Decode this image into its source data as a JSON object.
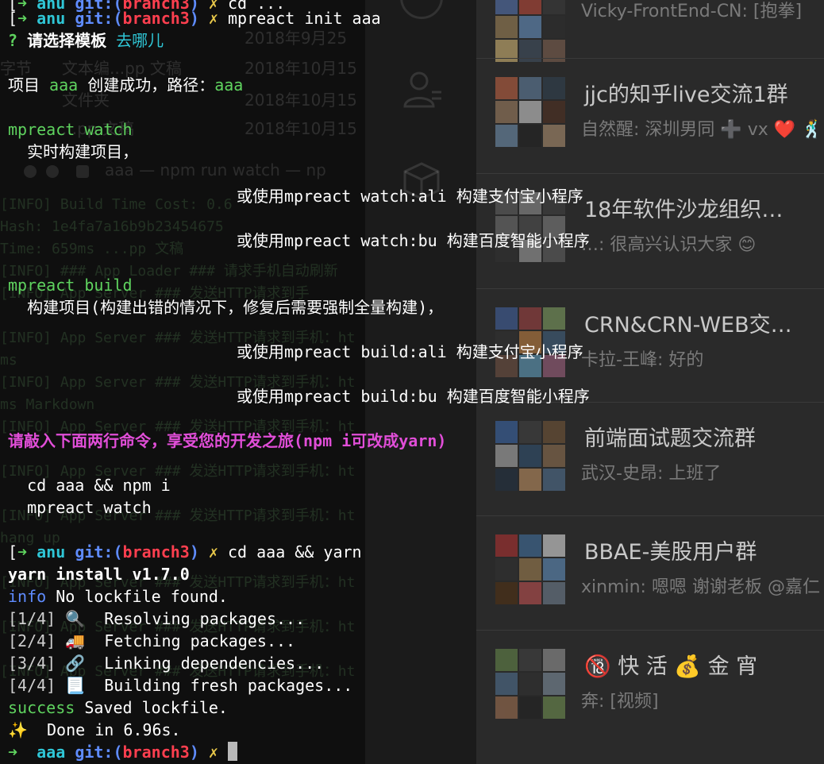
{
  "background_files": {
    "rows": [
      {
        "c1": "",
        "c2": "",
        "c3": "2018年9月25"
      },
      {
        "c1": "字节",
        "c2": "文本编...pp 文稿",
        "c3": "2018年10月15"
      },
      {
        "c1": "",
        "c2": "文件夹",
        "c3": "2018年10月15"
      },
      {
        "c1": "",
        "c2": "...pp 文稿",
        "c3": "2018年10月15"
      }
    ],
    "window_title": "aaa — npm run watch — np"
  },
  "background_terminal": {
    "lines": [
      "[INFO] Build Time Cost: 0.6",
      "Hash: 1e4fa7a16b9b23454675",
      "Time: 659ms    ...pp 文稿",
      "[INFO] ### App Loader ### 请求手机自动刷新",
      "[INFO] App Server ### 发送HTTP请求到手",
      "",
      "[INFO] App Server ### 发送HTTP请求到手机：ht",
      "ms",
      "[INFO] App Server ### 发送HTTP请求到手机：ht",
      "ms     Markdown",
      "[INFO] App Server ### 发送HTTP请求到手机：ht",
      "",
      "[INFO] App Server ### 发送HTTP请求到手机：ht",
      "",
      "[INFO] App Server ### 发送HTTP请求到手机：ht",
      "hang up",
      "",
      "[INFO] App Server ### 发送HTTP请求到手机：ht",
      "",
      "[INFO] App Server ### 发送HTTP请求到手机：ht",
      "",
      "[INFO] App Server ### 发送HTTP请求到手机：ht"
    ]
  },
  "chat_list": {
    "items": [
      {
        "name": "",
        "message": "Vicky-FrontEnd-CN: [抱拳]"
      },
      {
        "name": "jjc的知乎live交流1群",
        "message": "自然醒: 深圳男同 ➕ vx ❤️ 🕺"
      },
      {
        "name": "18年软件沙龙组织…",
        "message": "…: 很高兴认识大家 😊"
      },
      {
        "name": "CRN&CRN-WEB交…",
        "message": "卡拉-王峰: 好的"
      },
      {
        "name": "前端面试题交流群",
        "message": "武汉-史昂: 上班了"
      },
      {
        "name": "BBAE-美股用户群",
        "message": "xinmin: 嗯嗯  谢谢老板 @嘉仁"
      },
      {
        "name": "🔞 快 活 💰 金 宵",
        "message": "奔: [视频]"
      }
    ]
  },
  "terminal": {
    "prompt_arrow": "➜",
    "prompt_cross": "✗",
    "git_label": "git:(",
    "git_close": ")",
    "branch": "branch3",
    "line0": {
      "dir": "anu",
      "cmd": "cd ...",
      "bracket": "["
    },
    "line1": {
      "dir": "anu",
      "cmd": "mpreact init aaa",
      "bracket": "["
    },
    "question_mark": "?",
    "question": "请选择模板",
    "answer": "去哪儿",
    "created_a": "项目 ",
    "created_name": "aaa",
    "created_b": " 创建成功，路径：",
    "created_path": "aaa",
    "watch_cmd": "mpreact watch",
    "watch_desc": "  实时构建项目，",
    "watch_ali": "或使用mpreact watch:ali 构建支付宝小程序",
    "watch_bu": "或使用mpreact watch:bu 构建百度智能小程序",
    "build_cmd": "mpreact build",
    "build_desc": "  构建项目(构建出错的情况下，修复后需要强制全量构建)，",
    "build_ali": "或使用mpreact build:ali 构建支付宝小程序",
    "build_bu": "或使用mpreact build:bu 构建百度智能小程序",
    "hint": "请敲入下面两行命令，享受您的开发之旅(npm i可改成yarn)",
    "hint_cmd1": "  cd aaa && npm i",
    "hint_cmd2": "  mpreact watch",
    "line2": {
      "dir": "anu",
      "cmd": "cd aaa && yarn",
      "bracket": "["
    },
    "yarn_version": "yarn install v1.7.0",
    "info_label": "info",
    "info_text": " No lockfile found.",
    "steps": [
      {
        "num": "[1/4]",
        "icon": "🔍",
        "text": "  Resolving packages..."
      },
      {
        "num": "[2/4]",
        "icon": "🚚",
        "text": "  Fetching packages..."
      },
      {
        "num": "[3/4]",
        "icon": "🔗",
        "text": "  Linking dependencies..."
      },
      {
        "num": "[4/4]",
        "icon": "📃",
        "text": "  Building fresh packages..."
      }
    ],
    "success_label": "success",
    "success_text": " Saved lockfile.",
    "done_icon": "✨",
    "done_text": "  Done in 6.96s.",
    "line_final": {
      "dir": "aaa"
    }
  },
  "colors": {
    "prompt_green": "#5fd35f",
    "dir_cyan": "#2fc6d6",
    "git_blue": "#5f8cff",
    "branch_red": "#ff3f4f",
    "dirty_yellow": "#e8c84a",
    "hint_magenta": "#e14ed8"
  }
}
